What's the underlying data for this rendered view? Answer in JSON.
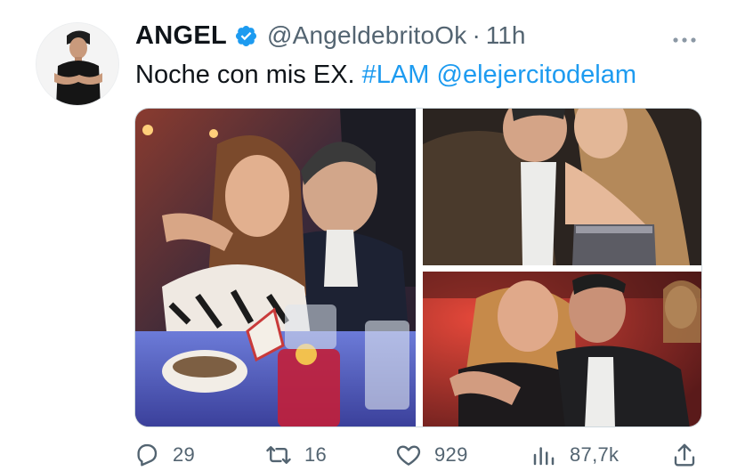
{
  "tweet": {
    "author": {
      "display_name": "ANGEL",
      "handle": "@AngeldebritoOk",
      "verified": true,
      "avatar_icon": "profile-photo"
    },
    "time_separator": "·",
    "timestamp": "11h",
    "more_icon": "more-dots-icon",
    "text_plain": "Noche con mis EX.",
    "hashtag": "#LAM",
    "mention": "@elejercitodelam",
    "media": [
      {
        "kind": "photo",
        "subject": "woman and man posing at restaurant table with drinks"
      },
      {
        "kind": "photo",
        "subject": "man and woman close-up selfie"
      },
      {
        "kind": "photo",
        "subject": "woman and man hugging in red-lit room"
      }
    ],
    "metrics": {
      "replies": "29",
      "retweets": "16",
      "likes": "929",
      "views": "87,7k"
    },
    "colors": {
      "link": "#1d9bf0",
      "verified_badge": "#1d9bf0",
      "secondary_text": "#536471"
    }
  }
}
